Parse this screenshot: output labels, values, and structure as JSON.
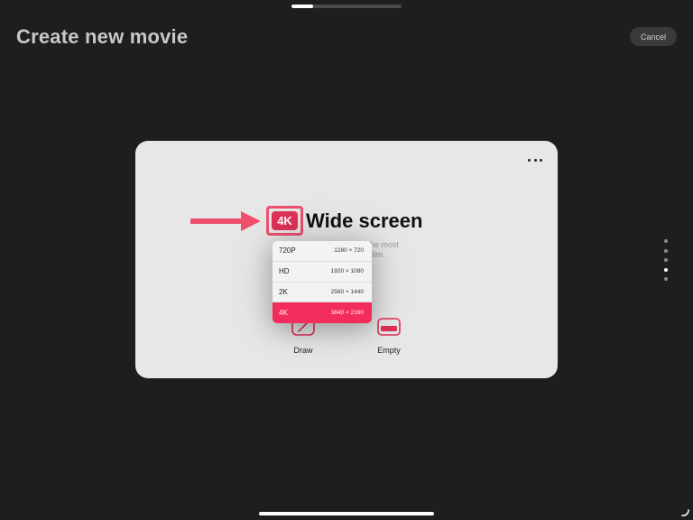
{
  "header": {
    "title": "Create new movie",
    "cancel_label": "Cancel",
    "progress_fraction": 0.2
  },
  "card": {
    "badge": "4K",
    "format_title": "Wide screen",
    "description": "he most\nfilm.",
    "resolutions": [
      {
        "name": "720P",
        "dims": "1280 × 720",
        "selected": false
      },
      {
        "name": "HD",
        "dims": "1920 × 1080",
        "selected": false
      },
      {
        "name": "2K",
        "dims": "2560 × 1440",
        "selected": false
      },
      {
        "name": "4K",
        "dims": "3840 × 2160",
        "selected": true
      }
    ],
    "options": [
      {
        "label": "Draw",
        "icon": "draw-icon"
      },
      {
        "label": "Empty",
        "icon": "empty-canvas-icon"
      }
    ]
  },
  "pager": {
    "count": 5,
    "active_index": 3
  },
  "colors": {
    "background": "#1e1e1e",
    "card": "#e7e7e7",
    "accent": "#f22d5c",
    "annotation_red": "#f0506e"
  }
}
